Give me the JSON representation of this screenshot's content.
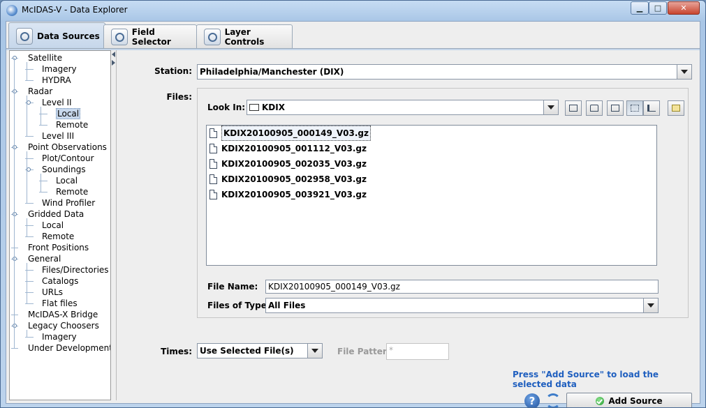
{
  "window": {
    "title": "McIDAS-V - Data Explorer"
  },
  "tabs": [
    {
      "label": "Data Sources",
      "active": true
    },
    {
      "label": "Field Selector",
      "active": false
    },
    {
      "label": "Layer Controls",
      "active": false
    }
  ],
  "tree": {
    "items": [
      {
        "label": "Satellite",
        "level": 0,
        "expanded": true
      },
      {
        "label": "Imagery",
        "level": 1
      },
      {
        "label": "HYDRA",
        "level": 1
      },
      {
        "label": "Radar",
        "level": 0,
        "expanded": true
      },
      {
        "label": "Level II",
        "level": 1,
        "expanded": true
      },
      {
        "label": "Local",
        "level": 2,
        "selected": true
      },
      {
        "label": "Remote",
        "level": 2
      },
      {
        "label": "Level III",
        "level": 1
      },
      {
        "label": "Point Observations",
        "level": 0,
        "expanded": true
      },
      {
        "label": "Plot/Contour",
        "level": 1
      },
      {
        "label": "Soundings",
        "level": 1,
        "expanded": true
      },
      {
        "label": "Local",
        "level": 2
      },
      {
        "label": "Remote",
        "level": 2
      },
      {
        "label": "Wind Profiler",
        "level": 1
      },
      {
        "label": "Gridded Data",
        "level": 0,
        "expanded": true
      },
      {
        "label": "Local",
        "level": 1
      },
      {
        "label": "Remote",
        "level": 1
      },
      {
        "label": "Front Positions",
        "level": 0
      },
      {
        "label": "General",
        "level": 0,
        "expanded": true
      },
      {
        "label": "Files/Directories",
        "level": 1
      },
      {
        "label": "Catalogs",
        "level": 1
      },
      {
        "label": "URLs",
        "level": 1
      },
      {
        "label": "Flat files",
        "level": 1
      },
      {
        "label": "McIDAS-X Bridge",
        "level": 0
      },
      {
        "label": "Legacy Choosers",
        "level": 0,
        "expanded": true
      },
      {
        "label": "Imagery",
        "level": 1
      },
      {
        "label": "Under Development",
        "level": 0
      }
    ]
  },
  "station": {
    "label": "Station:",
    "value": "Philadelphia/Manchester (DIX)"
  },
  "files": {
    "label": "Files:",
    "look_in_label": "Look In:",
    "look_in_value": "KDIX",
    "list": [
      {
        "name": "KDIX20100905_000149_V03.gz",
        "selected": true
      },
      {
        "name": "KDIX20100905_001112_V03.gz",
        "selected": false
      },
      {
        "name": "KDIX20100905_002035_V03.gz",
        "selected": false
      },
      {
        "name": "KDIX20100905_002958_V03.gz",
        "selected": false
      },
      {
        "name": "KDIX20100905_003921_V03.gz",
        "selected": false
      }
    ],
    "file_name_label": "File Name:",
    "file_name_value": "KDIX20100905_000149_V03.gz",
    "files_of_type_label": "Files of Type:",
    "files_of_type_value": "All Files"
  },
  "times": {
    "label": "Times:",
    "value": "Use Selected File(s)"
  },
  "file_pattern": {
    "label": "File Pattern:",
    "value": "*"
  },
  "hint": "Press \"Add Source\" to load the selected data",
  "add_source_label": "Add Source"
}
